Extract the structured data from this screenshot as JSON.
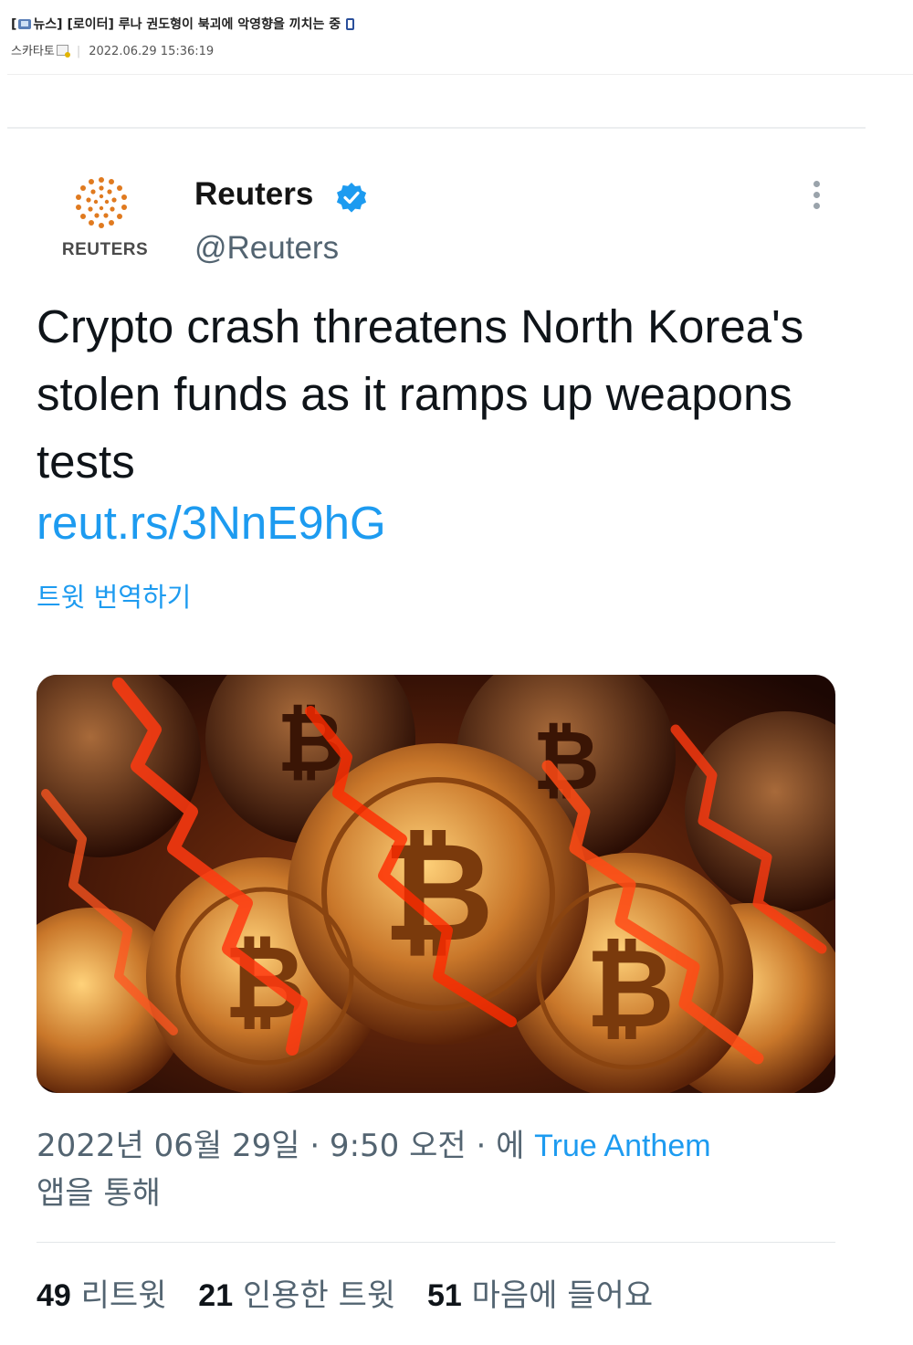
{
  "post": {
    "bracket_open": "[",
    "category": "뉴스]",
    "title": " [로이터] 루나 권도형이 북괴에 악영향을 끼치는 중",
    "author": "스카타토",
    "datetime": "2022.06.29 15:36:19",
    "separator": "|",
    "icons": {
      "category": "tv-icon",
      "device": "mobile-icon",
      "author": "author-level-icon"
    }
  },
  "image_index": "1",
  "tweet": {
    "logo_text": "REUTERS",
    "account_name": "Reuters",
    "handle": "@Reuters",
    "text": "Crypto crash threatens North Korea's stolen funds as it ramps up weapons tests",
    "link": "reut.rs/3NnE9hG",
    "translate_label": "트윗 번역하기",
    "timestamp": "2022년 06월 29일 · 9:50 오전 · 에 ",
    "source": "True Anthem",
    "source_suffix": "앱을 통해",
    "stats": [
      {
        "count": "49",
        "label": "리트윗"
      },
      {
        "count": "21",
        "label": "인용한 트윗"
      },
      {
        "count": "51",
        "label": "마음에 들어요"
      }
    ],
    "image_subject": "bitcoin coins with red falling chart lines",
    "colors": {
      "link": "#1d9bf0",
      "verified": "#1d9bf0",
      "secondary_text": "#536471",
      "logo": "#e07a1f"
    }
  }
}
